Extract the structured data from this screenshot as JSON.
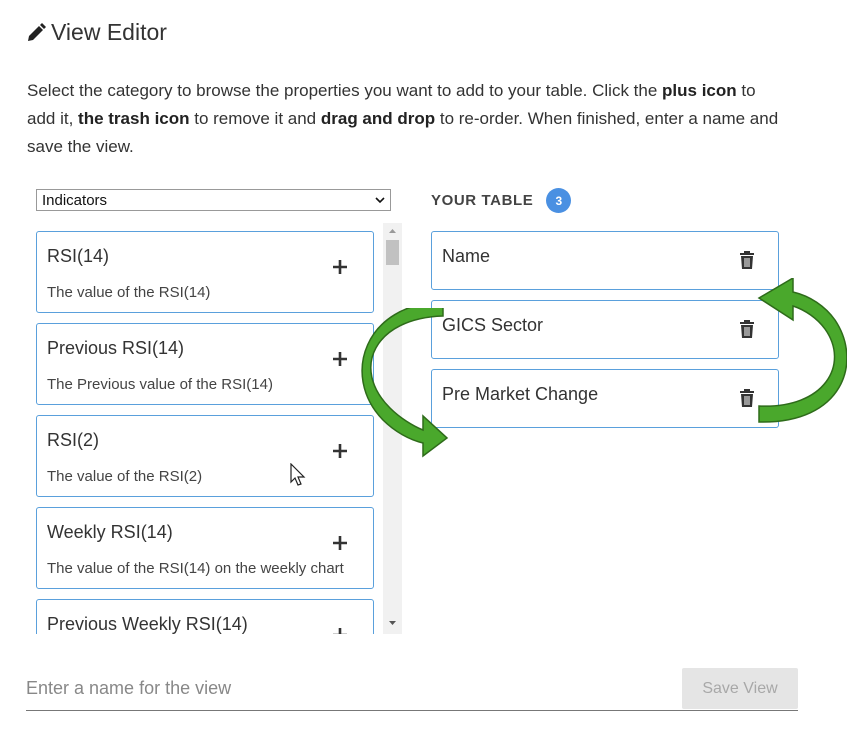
{
  "header": {
    "title": "View Editor",
    "icon": "pencil-icon"
  },
  "instructions": {
    "p1": "Select the category to browse the properties you want to add to your table. Click the ",
    "b1": "plus icon",
    "p2": " to add it, ",
    "b2": "the trash icon",
    "p3": " to remove it and ",
    "b3": "drag and drop",
    "p4": " to re-order. When finished, enter a name and save the view."
  },
  "category_select": {
    "selected": "Indicators"
  },
  "properties": [
    {
      "name": "RSI(14)",
      "description": "The value of the RSI(14)"
    },
    {
      "name": "Previous RSI(14)",
      "description": "The Previous value of the RSI(14)"
    },
    {
      "name": "RSI(2)",
      "description": "The value of the RSI(2)"
    },
    {
      "name": "Weekly RSI(14)",
      "description": "The value of the RSI(14) on the weekly chart"
    },
    {
      "name": "Previous Weekly RSI(14)",
      "description": ""
    }
  ],
  "your_table": {
    "label": "YOUR TABLE",
    "count": "3",
    "columns": [
      {
        "name": "Name"
      },
      {
        "name": "GICS Sector"
      },
      {
        "name": "Pre Market Change"
      }
    ]
  },
  "footer": {
    "name_placeholder": "Enter a name for the view",
    "name_value": "",
    "save_label": "Save View"
  },
  "colors": {
    "accent": "#4a90e2",
    "card_border": "#5aa0dc",
    "arrow": "#4aa82c"
  }
}
